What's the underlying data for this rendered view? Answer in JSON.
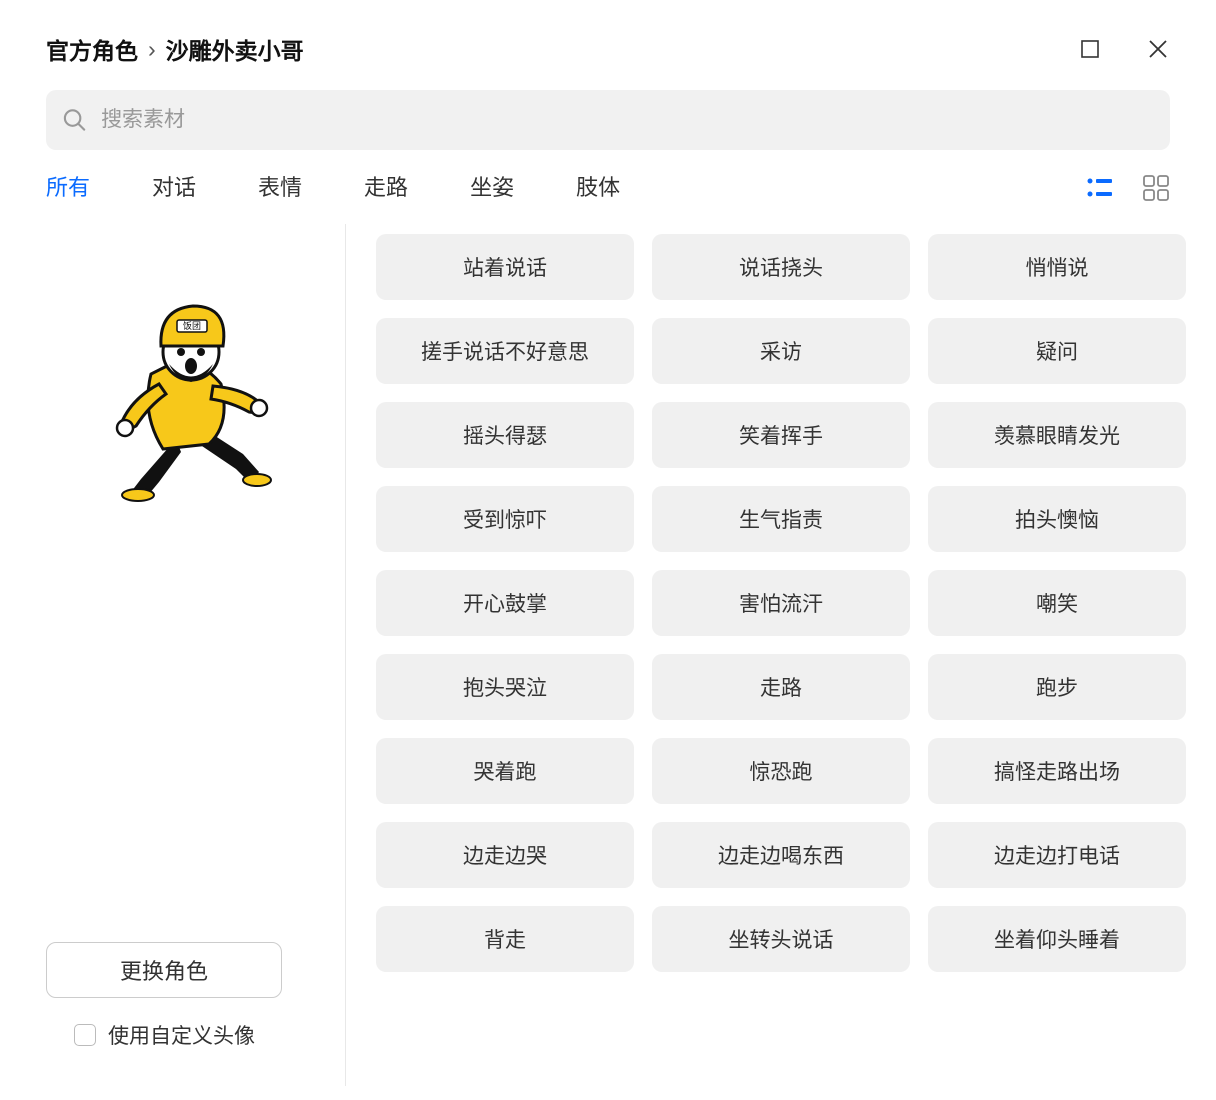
{
  "breadcrumb": {
    "root": "官方角色",
    "sep": "›",
    "current": "沙雕外卖小哥"
  },
  "search": {
    "placeholder": "搜索素材"
  },
  "tabs": [
    "所有",
    "对话",
    "表情",
    "走路",
    "坐姿",
    "肢体"
  ],
  "activeTabIndex": 0,
  "sidebar": {
    "switch_label": "更换角色",
    "custom_avatar_label": "使用自定义头像",
    "helmet_text": "饭团"
  },
  "poses": [
    "站着说话",
    "说话挠头",
    "悄悄说",
    "搓手说话不好意思",
    "采访",
    "疑问",
    "摇头得瑟",
    "笑着挥手",
    "羡慕眼睛发光",
    "受到惊吓",
    "生气指责",
    "拍头懊恼",
    "开心鼓掌",
    "害怕流汗",
    "嘲笑",
    "抱头哭泣",
    "走路",
    "跑步",
    "哭着跑",
    "惊恐跑",
    "搞怪走路出场",
    "边走边哭",
    "边走边喝东西",
    "边走边打电话",
    "背走",
    "坐转头说话",
    "坐着仰头睡着"
  ],
  "colors": {
    "accent": "#0b6bff",
    "character_yellow": "#f7c81a"
  }
}
